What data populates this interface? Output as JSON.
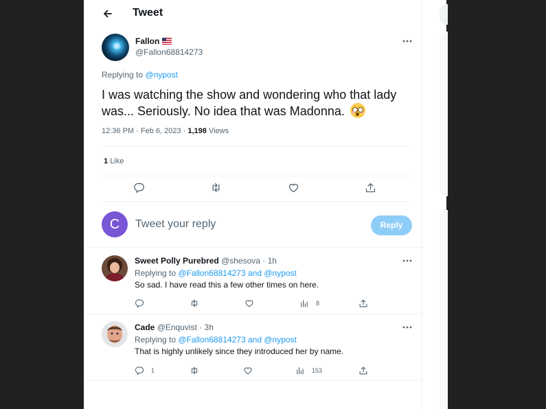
{
  "header": {
    "title": "Tweet"
  },
  "tweet": {
    "author_name": "Fallon",
    "author_handle": "@Fallon68814273",
    "replying_prefix": "Replying to",
    "replying_to": "@nypost",
    "text": "I was watching the show and wondering who that lady was... Seriously. No idea that was Madonna.",
    "time": "12:36 PM · Feb 6, 2023 ·",
    "views_count": "1,198",
    "views_label": "Views",
    "likes_count": "1",
    "likes_label": "Like"
  },
  "compose": {
    "avatar_letter": "C",
    "placeholder": "Tweet your reply",
    "button_label": "Reply"
  },
  "replies": [
    {
      "name": "Sweet Polly Purebred",
      "handle": "@shesova · 1h",
      "replying_prefix": "Replying to",
      "replying_to": "@Fallon68814273 and @nypost",
      "text": "So sad. I have read this a few other times on here.",
      "reply_count": "",
      "views_count": "8"
    },
    {
      "name": "Cade",
      "handle": "@Enquvist · 3h",
      "replying_prefix": "Replying to",
      "replying_to": "@Fallon68814273 and @nypost",
      "text": "That is highly unlikely since they introduced her by name.",
      "reply_count": "1",
      "views_count": "153"
    }
  ],
  "colors": {
    "link": "#1d9bf0",
    "reply_button": "#8ecdf8",
    "compose_avatar": "#7856d5"
  }
}
